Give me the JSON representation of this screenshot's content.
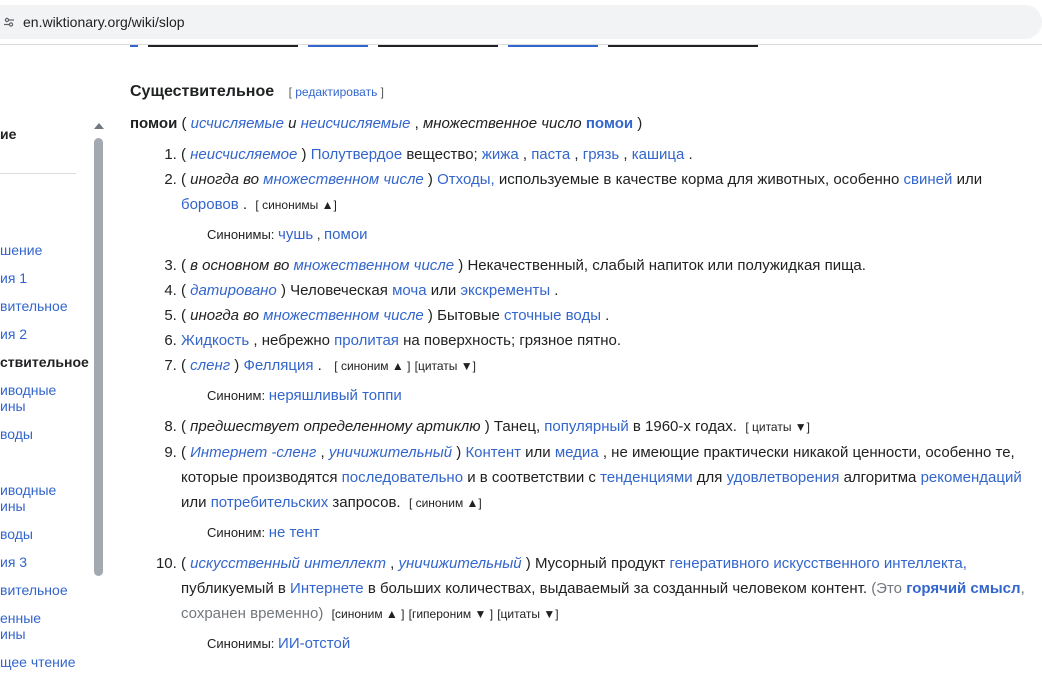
{
  "browser": {
    "url": "en.wiktionary.org/wiki/slop"
  },
  "sidebar": {
    "items": [
      {
        "label": "ие",
        "current": true
      },
      {
        "label": "шение",
        "current": false
      },
      {
        "label": "ия 1",
        "current": false
      },
      {
        "label": "вительное",
        "current": false
      },
      {
        "label": "ия 2",
        "current": false
      },
      {
        "label": "ствительное",
        "current": true
      },
      {
        "label": "иводные",
        "current": false
      },
      {
        "label": "ины",
        "current": false
      },
      {
        "label": "воды",
        "current": false
      },
      {
        "label": "иводные",
        "current": false
      },
      {
        "label": "ины",
        "current": false
      },
      {
        "label": "воды",
        "current": false
      },
      {
        "label": "ия 3",
        "current": false
      },
      {
        "label": "вительное",
        "current": false
      },
      {
        "label": "енные",
        "current": false
      },
      {
        "label": "ины",
        "current": false
      },
      {
        "label": "щее чтение",
        "current": false
      }
    ]
  },
  "section": {
    "title": "Существительное",
    "edit_label": "редактировать"
  },
  "headword": {
    "word": "помои",
    "open": "(",
    "close": ")",
    "q1": "исчисляемые",
    "and": "и",
    "q2": "неисчисляемые",
    "comma": ",",
    "plural_label": "множественное число",
    "plural": "помои"
  },
  "senses": {
    "s1": {
      "q": "неисчисляемое",
      "link1": "Полутвердое",
      "t1": "вещество;",
      "link2": "жижа",
      "link3": "паста",
      "link4": "грязь",
      "link5": "кашица"
    },
    "s2": {
      "q_plain": "иногда во",
      "q_link": "множественном числе",
      "link1": "Отходы,",
      "t1": "используемые в качестве корма для животных, особенно",
      "link2": "свиней",
      "t2": "или",
      "link3": "боровов",
      "ctrl": "[ синонимы ▲]",
      "syn_label": "Синонимы:",
      "syn1": "чушь",
      "syn2": "помои"
    },
    "s3": {
      "q_plain": "в основном во",
      "q_link": "множественном числе",
      "t1": "Некачественный, слабый напиток или полужидкая пища."
    },
    "s4": {
      "q": "датировано",
      "t1": "Человеческая",
      "link1": "моча",
      "t2": "или",
      "link2": "экскременты"
    },
    "s5": {
      "q_plain": "иногда во",
      "q_link": "множественном числе",
      "t1": "Бытовые",
      "link1": "сточные воды"
    },
    "s6": {
      "link1": "Жидкость",
      "t1": ", небрежно",
      "link2": "пролитая",
      "t2": "на поверхность; грязное пятно."
    },
    "s7": {
      "q": "сленг",
      "link1": "Фелляция",
      "ctrl1": "[ синоним ▲ ]",
      "ctrl2": "[цитаты ▼]",
      "syn_label": "Синоним:",
      "syn1": "неряшливый топпи"
    },
    "s8": {
      "q": "предшествует определенному артиклю",
      "t1": "Танец,",
      "link1": "популярный",
      "t2": "в 1960-х годах.",
      "ctrl": "[ цитаты ▼]"
    },
    "s9": {
      "q1": "Интернет -сленг",
      "q2": "уничижительный",
      "link1": "Контент",
      "t1": "или",
      "link2": "медиа",
      "t2": ", не имеющие практически никакой ценности, особенно те, которые производятся",
      "link3": "последовательно",
      "t3": "и в соответствии с",
      "link4": "тенденциями",
      "t4": "для",
      "link5": "удовлетворения",
      "t5": "алгоритма",
      "link6": "рекомендаций",
      "t6": "или",
      "link7": "потребительских",
      "t7": "запросов.",
      "ctrl": "[ синоним ▲]",
      "syn_label": "Синоним:",
      "syn1": "не тент"
    },
    "s10": {
      "q1": "искусственный интеллект",
      "q2": "уничижительный",
      "t1": "Мусорный продукт",
      "link1": "генеративного искусственного интеллекта,",
      "t2": "публикуемый в",
      "link2": "Интернете",
      "t3": "в больших количествах, выдаваемый за созданный человеком контент.",
      "note_open": "(Это",
      "note_link": "горячий смысл",
      "note_rest": ", сохранен временно)",
      "ctrl1": "[синоним ▲ ]",
      "ctrl2": "[гипероним ▼ ]",
      "ctrl3": "[цитаты ▼]",
      "syn_label": "Синонимы:",
      "syn1": "ИИ-отстой"
    }
  }
}
